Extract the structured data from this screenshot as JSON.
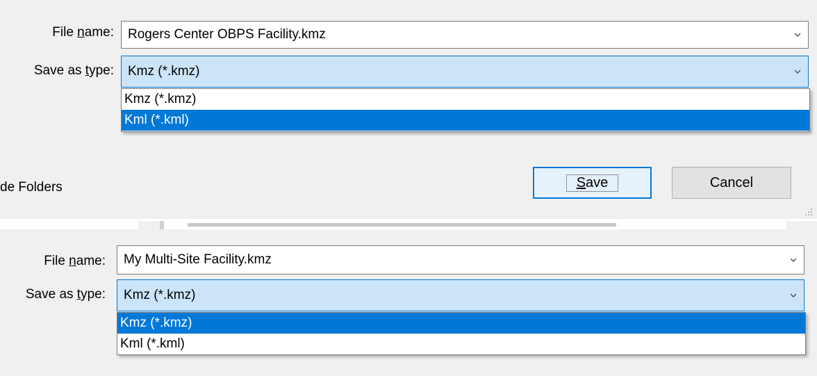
{
  "dialog1": {
    "file_name_label_pre": "File ",
    "file_name_label_u": "n",
    "file_name_label_post": "ame:",
    "file_name_value": "Rogers Center OBPS Facility.kmz",
    "save_type_label_pre": "Save as ",
    "save_type_label_u": "t",
    "save_type_label_post": "ype:",
    "save_type_value": "Kmz (*.kmz)",
    "options": [
      "Kmz (*.kmz)",
      "Kml (*.kml)"
    ],
    "highlighted_option": "Kml (*.kml)",
    "hide_folders_text": "de Folders",
    "save_button_u": "S",
    "save_button_rest": "ave",
    "cancel_button": "Cancel"
  },
  "dialog2": {
    "file_name_label_pre": "File ",
    "file_name_label_u": "n",
    "file_name_label_post": "ame:",
    "file_name_value": "My Multi-Site Facility.kmz",
    "save_type_label_pre": "Save as ",
    "save_type_label_u": "t",
    "save_type_label_post": "ype:",
    "save_type_value": "Kmz (*.kmz)",
    "options": [
      "Kmz (*.kmz)",
      "Kml (*.kml)"
    ],
    "highlighted_option": "Kmz (*.kmz)"
  },
  "icons": {
    "chevron": "chevron-down-icon",
    "grip": "resize-grip-icon"
  },
  "colors": {
    "accent": "#0078d7",
    "selected_field_bg": "#cce4f7",
    "dialog_bg": "#f0f0f0"
  }
}
